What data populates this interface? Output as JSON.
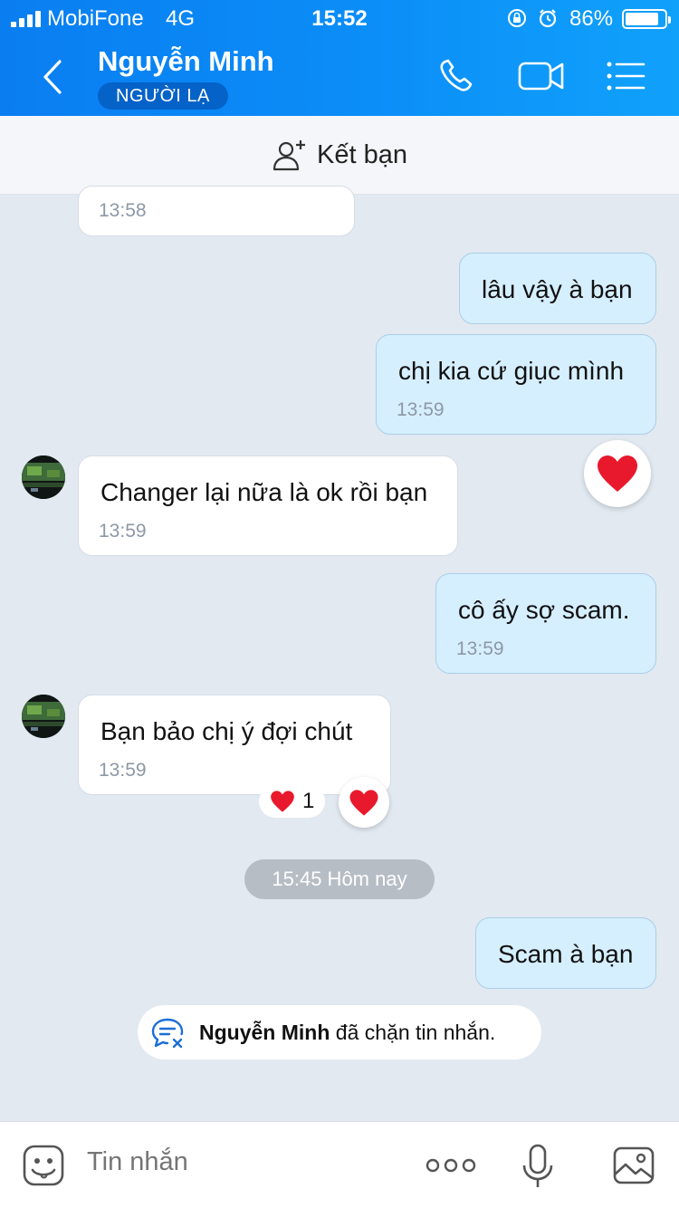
{
  "status_bar": {
    "carrier": "MobiFone",
    "network": "4G",
    "time": "15:52",
    "battery": "86%",
    "battery_level": 0.86
  },
  "header": {
    "contact_name": "Nguyễn Minh",
    "badge": "NGƯỜI LẠ"
  },
  "friend_bar": {
    "label": "Kết bạn"
  },
  "messages": [
    {
      "side": "received",
      "text": "",
      "time": "13:58"
    },
    {
      "side": "sent",
      "text": "lâu vậy à bạn",
      "time": ""
    },
    {
      "side": "sent",
      "text": "chị kia cứ giục mình",
      "time": "13:59"
    },
    {
      "side": "received",
      "text": "Changer lại nữa là ok rồi bạn",
      "time": "13:59"
    },
    {
      "side": "sent",
      "text": "cô ấy sợ scam.",
      "time": "13:59"
    },
    {
      "side": "received",
      "text": "Bạn bảo chị ý đợi chút",
      "time": "13:59",
      "reaction_count": "1"
    },
    {
      "side": "sent",
      "text": "Scam à bạn",
      "time": ""
    }
  ],
  "date_separator": "15:45 Hôm nay",
  "blocked_notice": {
    "name": "Nguyễn Minh",
    "text": " đã chặn tin nhắn."
  },
  "composer": {
    "placeholder": "Tin nhắn"
  },
  "colors": {
    "header": "#0b8cf7",
    "sent_bubble": "#d6efff",
    "background": "#e2e9f1"
  }
}
